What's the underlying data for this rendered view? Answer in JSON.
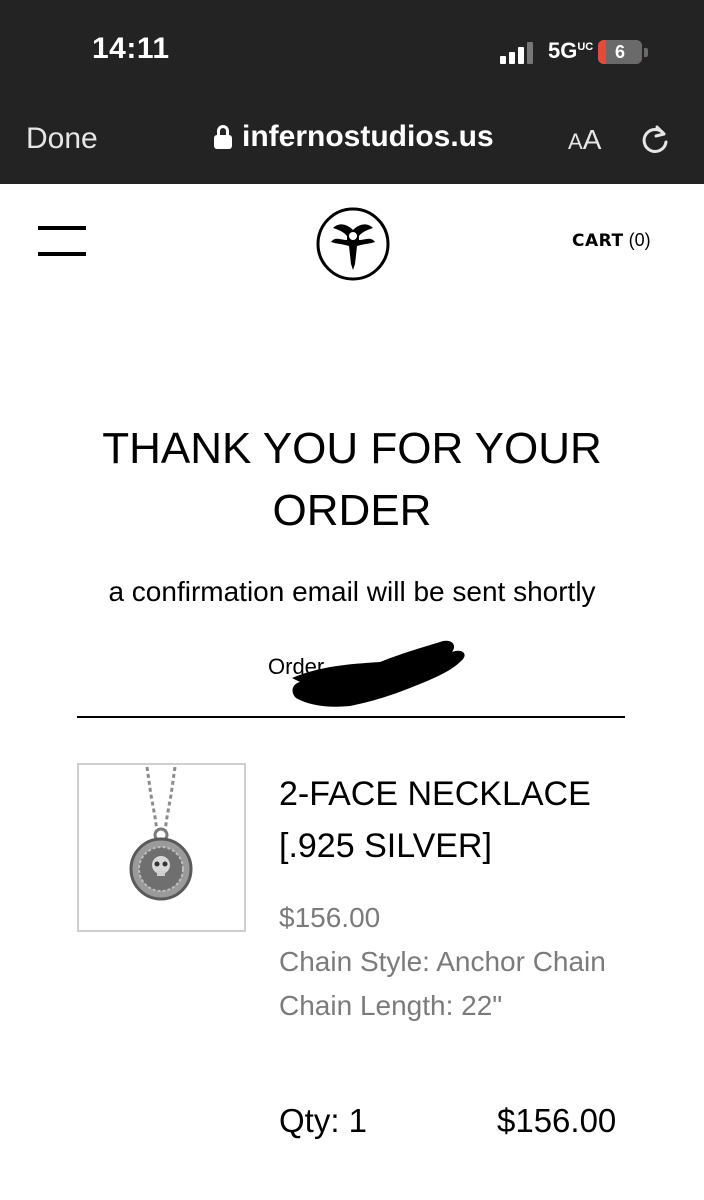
{
  "status_bar": {
    "time": "14:11",
    "network": "5G",
    "network_sup": "UC",
    "battery": "6"
  },
  "browser": {
    "done_label": "Done",
    "url": "infernostudios.us",
    "text_size_small": "A",
    "text_size_big": "A"
  },
  "header": {
    "cart_label": "CART",
    "cart_count": "(0)"
  },
  "confirmation": {
    "title": "THANK YOU FOR YOUR ORDER",
    "subtitle": "a confirmation email will be sent shortly",
    "order_label": "Order"
  },
  "order_item": {
    "name": "2-FACE NECKLACE [.925 SILVER]",
    "price": "$156.00",
    "chain_style": "Chain Style: Anchor Chain",
    "chain_length": "Chain Length: 22\"",
    "quantity": "Qty: 1",
    "line_total": "$156.00"
  }
}
